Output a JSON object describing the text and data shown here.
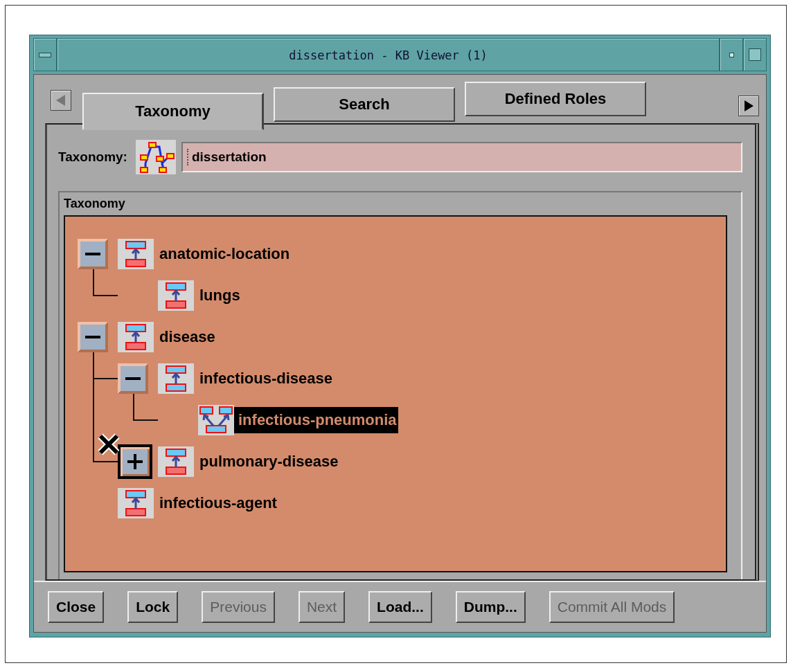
{
  "window": {
    "title": "dissertation - KB Viewer (1)"
  },
  "tabs": [
    {
      "label": "Taxonomy",
      "selected": true
    },
    {
      "label": "Search",
      "selected": false
    },
    {
      "label": "Defined Roles",
      "selected": false
    }
  ],
  "taxonomy_field": {
    "label": "Taxonomy:",
    "value": "dissertation"
  },
  "group": {
    "title": "Taxonomy"
  },
  "tree": [
    {
      "label": "anatomic-location",
      "kind": "primitive",
      "expanded": true,
      "focused": false,
      "selected": false,
      "children": [
        {
          "label": "lungs",
          "kind": "primitive",
          "selected": false
        }
      ]
    },
    {
      "label": "disease",
      "kind": "primitive",
      "expanded": true,
      "focused": false,
      "selected": false,
      "children": [
        {
          "label": "infectious-disease",
          "kind": "defined",
          "expanded": true,
          "focused": false,
          "selected": false,
          "children": [
            {
              "label": "infectious-pneumonia",
              "kind": "multi",
              "selected": true
            }
          ]
        },
        {
          "label": "pulmonary-disease",
          "kind": "primitive",
          "expanded": false,
          "focused": true,
          "selected": false
        }
      ]
    },
    {
      "label": "infectious-agent",
      "kind": "primitive",
      "selected": false
    }
  ],
  "buttons": [
    {
      "label": "Close",
      "disabled": false
    },
    {
      "label": "Lock",
      "disabled": false
    },
    {
      "label": "Previous",
      "disabled": true
    },
    {
      "label": "Next",
      "disabled": true
    },
    {
      "label": "Load...",
      "disabled": false
    },
    {
      "label": "Dump...",
      "disabled": false
    },
    {
      "label": "Commit All Mods",
      "disabled": true
    }
  ]
}
